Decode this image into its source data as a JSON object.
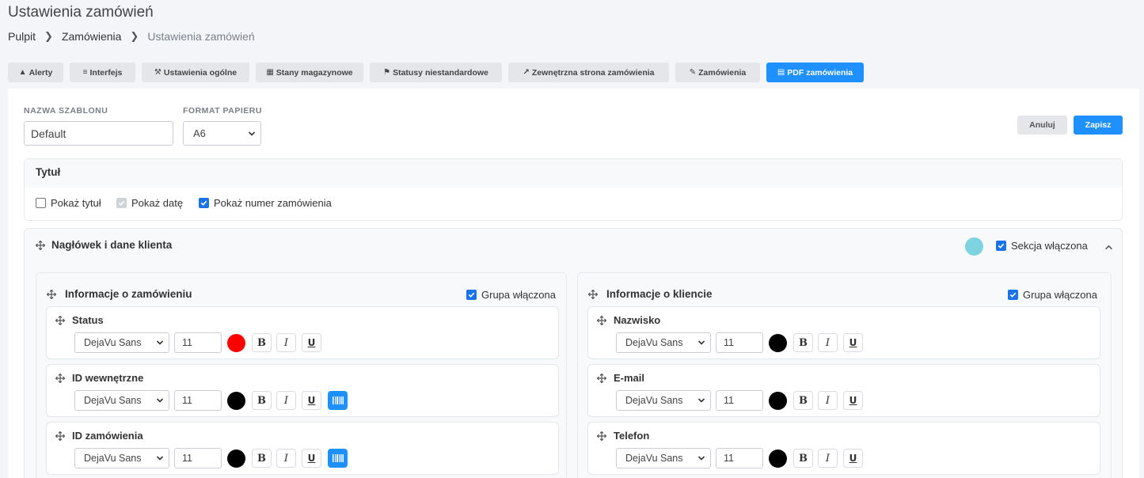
{
  "page": {
    "title": "Ustawienia zamówień"
  },
  "breadcrumb": [
    "Pulpit",
    "Zamówienia",
    "Ustawienia zamówień"
  ],
  "tabs": [
    {
      "label": "Alerty",
      "icon": "bell-icon"
    },
    {
      "label": "Interfejs",
      "icon": "list-icon"
    },
    {
      "label": "Ustawienia ogólne",
      "icon": "wrench-icon"
    },
    {
      "label": "Stany magazynowe",
      "icon": "boxes-icon"
    },
    {
      "label": "Statusy niestandardowe",
      "icon": "flag-icon"
    },
    {
      "label": "Zewnętrzna strona zamówienia",
      "icon": "external-link-icon"
    },
    {
      "label": "Zamówienia",
      "icon": "edit-icon"
    },
    {
      "label": "PDF zamówienia",
      "icon": "file-icon",
      "active": true
    }
  ],
  "form": {
    "template_name_label": "NAZWA SZABLONU",
    "template_name_value": "Default",
    "paper_format_label": "FORMAT PAPIERU",
    "paper_format_value": "A6",
    "cancel_label": "Anuluj",
    "save_label": "Zapisz"
  },
  "title_section": {
    "heading": "Tytuł",
    "show_title": {
      "label": "Pokaż tytuł",
      "checked": false
    },
    "show_date": {
      "label": "Pokaż datę",
      "checked": true,
      "disabled": true
    },
    "show_order_number": {
      "label": "Pokaż numer zamówienia",
      "checked": true
    }
  },
  "header_section": {
    "heading": "Nagłówek i dane klienta",
    "color": "#7dd3e0",
    "enabled_label": "Sekcja włączona",
    "groups": [
      {
        "heading": "Informacje o zamówieniu",
        "enabled_label": "Grupa włączona",
        "fields": [
          {
            "name": "Status",
            "font": "DejaVu Sans",
            "size": "11",
            "color": "#ff0000",
            "barcode": false
          },
          {
            "name": "ID wewnętrzne",
            "font": "DejaVu Sans",
            "size": "11",
            "color": "#000000",
            "barcode": true
          },
          {
            "name": "ID zamówienia",
            "font": "DejaVu Sans",
            "size": "11",
            "color": "#000000",
            "barcode": true
          }
        ]
      },
      {
        "heading": "Informacje o kliencie",
        "enabled_label": "Grupa włączona",
        "fields": [
          {
            "name": "Nazwisko",
            "font": "DejaVu Sans",
            "size": "11",
            "color": "#000000",
            "barcode": false
          },
          {
            "name": "E-mail",
            "font": "DejaVu Sans",
            "size": "11",
            "color": "#000000",
            "barcode": false
          },
          {
            "name": "Telefon",
            "font": "DejaVu Sans",
            "size": "11",
            "color": "#000000",
            "barcode": false
          }
        ]
      }
    ]
  },
  "format_buttons": {
    "bold": "B",
    "italic": "I",
    "underline": "U"
  },
  "colors": {
    "accent": "#1e90ff",
    "tab_bg": "#e4e6ea"
  }
}
